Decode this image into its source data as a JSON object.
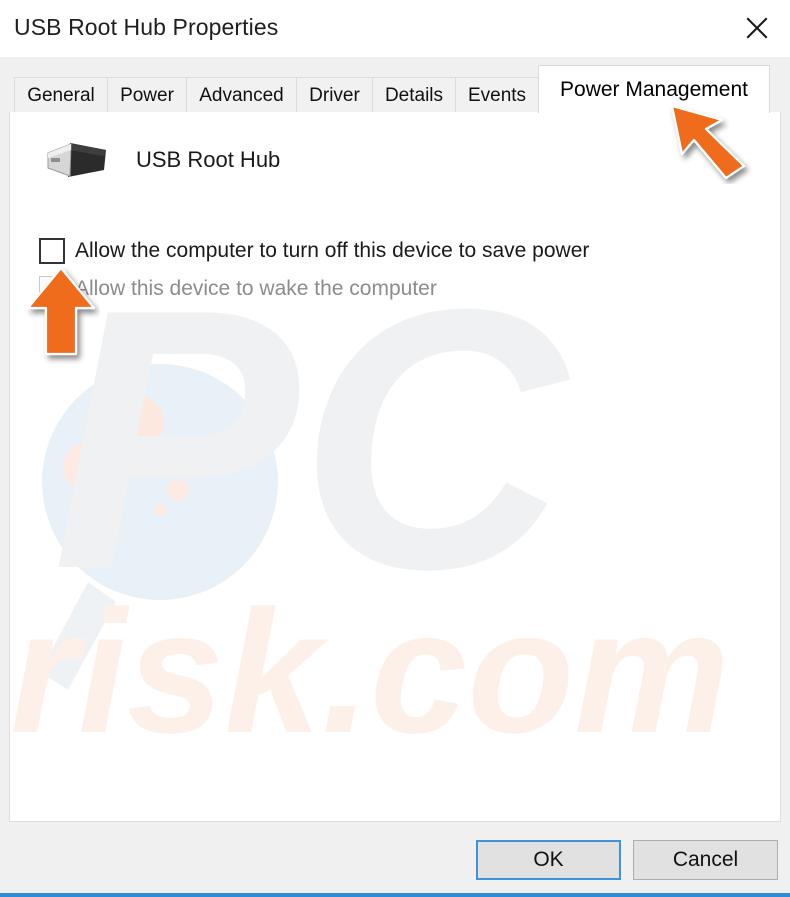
{
  "window": {
    "title": "USB Root Hub Properties",
    "close_icon": "close-icon"
  },
  "tabs": [
    {
      "label": "General",
      "active": false
    },
    {
      "label": "Power",
      "active": false
    },
    {
      "label": "Advanced",
      "active": false
    },
    {
      "label": "Driver",
      "active": false
    },
    {
      "label": "Details",
      "active": false
    },
    {
      "label": "Events",
      "active": false
    },
    {
      "label": "Power Management",
      "active": true
    }
  ],
  "content": {
    "device_icon": "usb-connector-icon",
    "device_name": "USB Root Hub",
    "checkboxes": [
      {
        "label": "Allow the computer to turn off this device to save power",
        "checked": false,
        "disabled": false
      },
      {
        "label": "Allow this device to wake the computer",
        "checked": false,
        "disabled": true
      }
    ]
  },
  "footer": {
    "ok_label": "OK",
    "cancel_label": "Cancel"
  },
  "watermark": {
    "text_primary": "PC",
    "text_secondary": "risk.com"
  },
  "annotations": [
    {
      "name": "arrow-pointing-to-power-management-tab",
      "direction": "up-left"
    },
    {
      "name": "arrow-pointing-to-wake-checkbox",
      "direction": "up"
    }
  ],
  "colors": {
    "accent_orange": "#ef6c1f",
    "focus_blue": "#3c93d8",
    "bottom_border_blue": "#2e8bd4",
    "dialog_chrome": "#f0f0f0",
    "panel_background": "#ffffff",
    "disabled_text": "#8c8c8c"
  }
}
